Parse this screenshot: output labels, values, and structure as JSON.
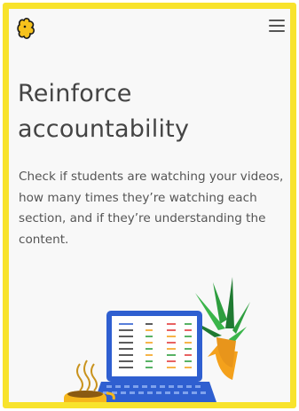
{
  "header": {
    "logo_icon": "puzzle-logo-icon",
    "menu_icon": "hamburger-menu-icon"
  },
  "main": {
    "headline": "Reinforce accountability",
    "body": "Check if students are watching your videos, how many times they’re watching each section, and if they’re understanding the content."
  },
  "illustration": {
    "icons": [
      "plant-icon",
      "laptop-icon",
      "coffee-mug-icon"
    ]
  },
  "colors": {
    "frame": "#f8e32c",
    "background": "#f8f8f8",
    "text": "#444444",
    "laptop": "#2f5fd0",
    "plant": "#2e9e3f"
  }
}
